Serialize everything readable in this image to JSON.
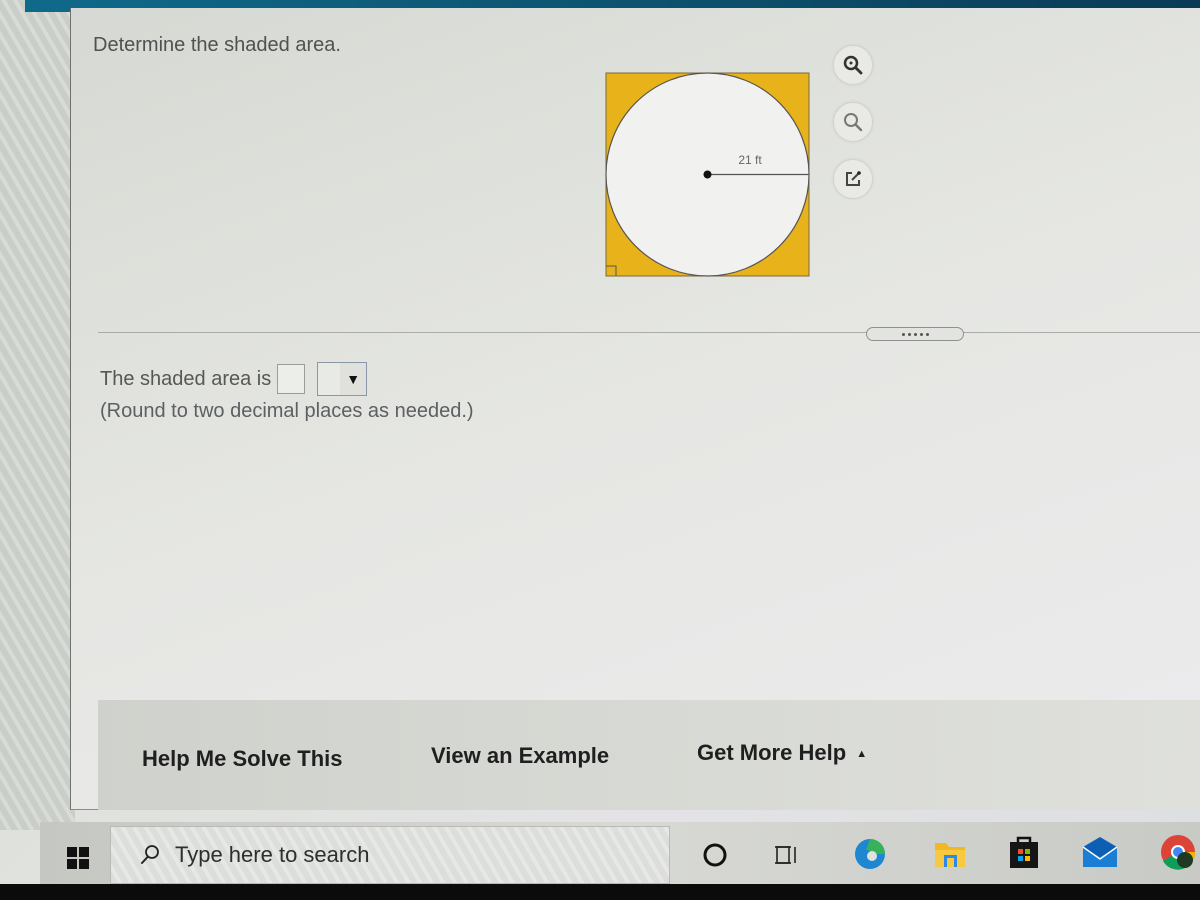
{
  "question": {
    "prompt": "Determine the shaded area.",
    "figure": {
      "radius_label": "21 ft",
      "shaded_color": "#e8b21a",
      "circle_fill": "#f1f2ef"
    },
    "tools": [
      {
        "name": "zoom-in",
        "label": "Zoom in"
      },
      {
        "name": "zoom-out",
        "label": "Zoom out"
      },
      {
        "name": "pop-out",
        "label": "Open in new window"
      }
    ],
    "answer": {
      "prefix": "The shaded area is",
      "value": "",
      "unit_selected": "",
      "dropdown_arrow": "▼",
      "hint": "(Round to two decimal places as needed.)"
    }
  },
  "help": {
    "help_me_solve": "Help Me Solve This",
    "view_example": "View an Example",
    "get_more_help": "Get More Help",
    "get_more_help_arrow": "▲"
  },
  "taskbar": {
    "search_placeholder": "Type here to search",
    "apps": [
      "cortana",
      "task-view",
      "edge",
      "file-explorer",
      "store",
      "mail",
      "chrome"
    ]
  }
}
